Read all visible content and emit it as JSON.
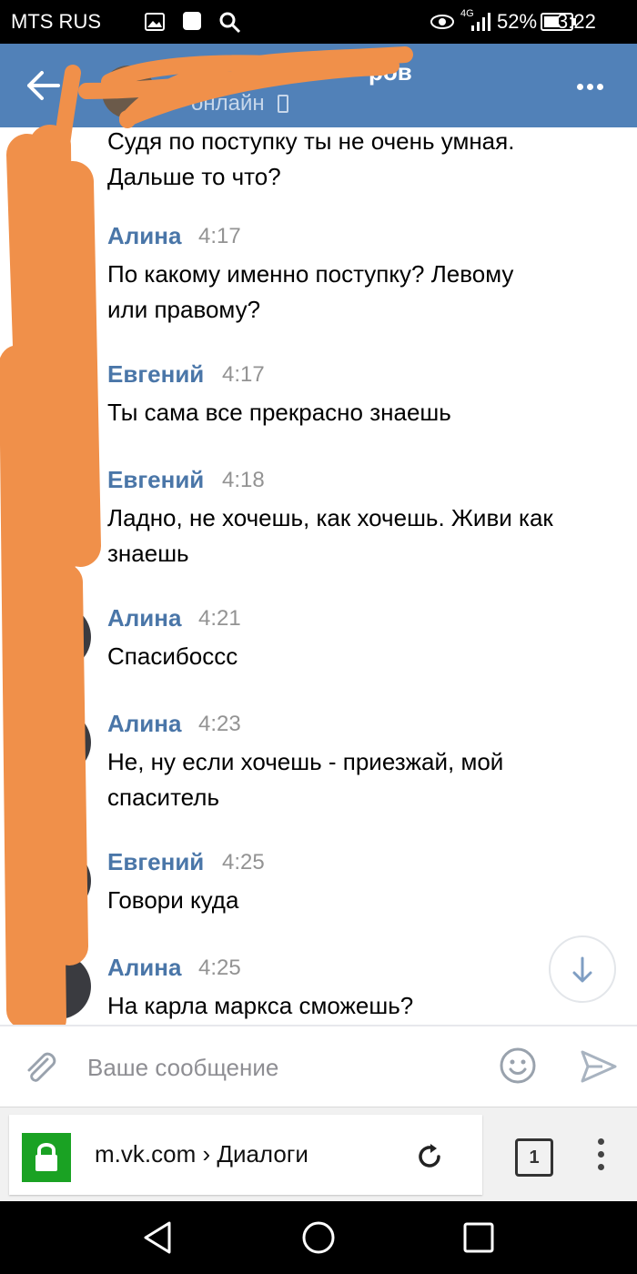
{
  "status_bar": {
    "carrier": "MTS RUS",
    "network": "4G",
    "battery": "52%",
    "time": "3:22"
  },
  "header": {
    "name_visible": "ров",
    "status": "онлайн"
  },
  "messages": [
    {
      "author": "",
      "time": "",
      "text": "Судя по поступку ты не очень умная.\nДальше то что?"
    },
    {
      "author": "Алина",
      "time": "4:17",
      "text": "По какому именно поступку? Левому\nили правому?"
    },
    {
      "author": "Евгений",
      "time": "4:17",
      "text": "Ты сама все прекрасно знаешь"
    },
    {
      "author": "Евгений",
      "time": "4:18",
      "text": "Ладно, не хочешь, как хочешь. Живи как\nзнаешь"
    },
    {
      "author": "Алина",
      "time": "4:21",
      "text": "Спасибоссс"
    },
    {
      "author": "Алина",
      "time": "4:23",
      "text": "Не, ну если хочешь - приезжай, мой\nспаситель"
    },
    {
      "author": "Евгений",
      "time": "4:25",
      "text": "Говори куда"
    },
    {
      "author": "Алина",
      "time": "4:25",
      "text": "На карла маркса сможешь?"
    }
  ],
  "composer": {
    "placeholder": "Ваше сообщение"
  },
  "browser": {
    "url": "m.vk.com › Диалоги",
    "tab_count": "1"
  },
  "colors": {
    "header": "#5181b8",
    "author": "#4a76a8",
    "scribble": "#f0904a",
    "lock": "#1aa223"
  }
}
